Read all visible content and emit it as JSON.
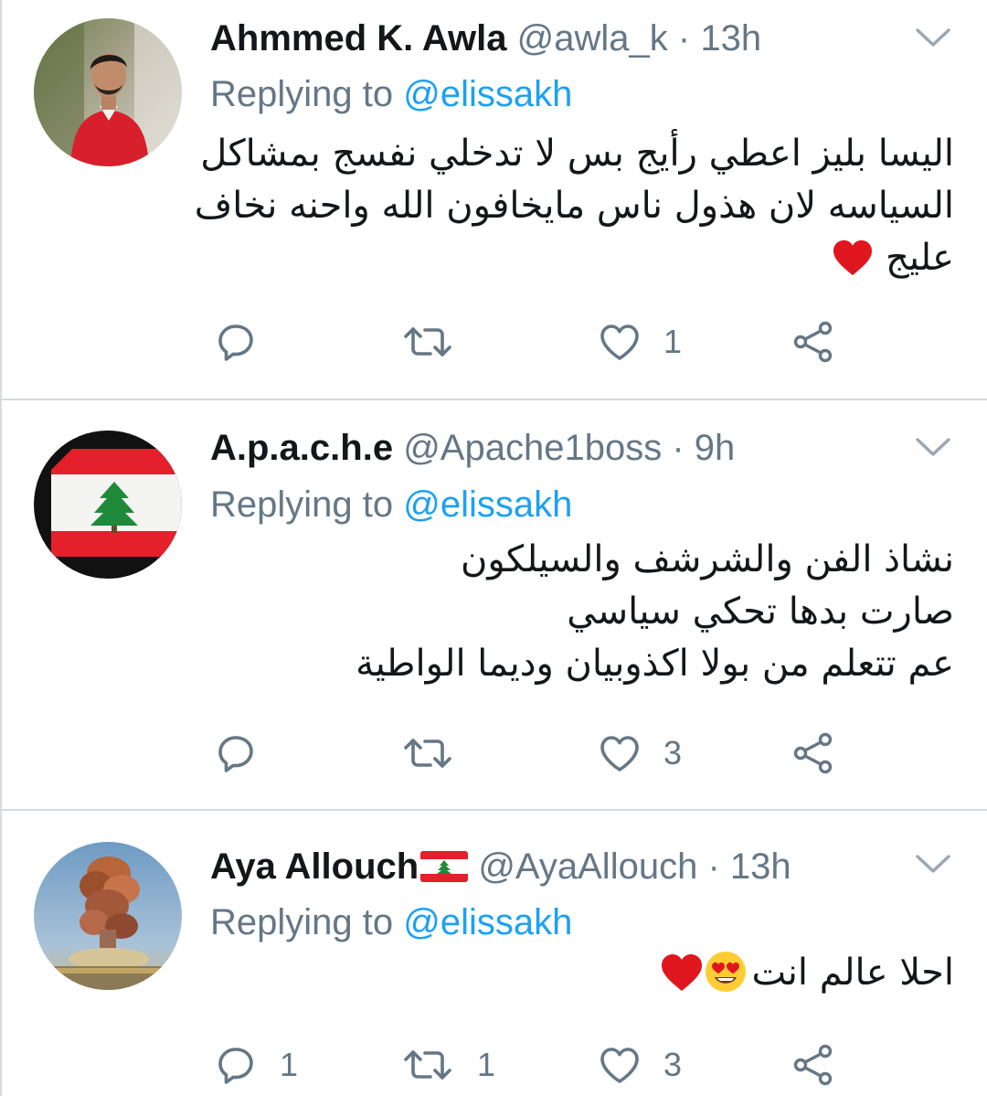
{
  "theme": {
    "text": "#14171a",
    "muted": "#657786",
    "link": "#1da1f2",
    "heart": "#e0161e",
    "divider": "#d6dadf"
  },
  "tweets": [
    {
      "name": "Ahmmed K. Awla",
      "handle": "@awla_k",
      "separator": "·",
      "time": "13h",
      "replying_label": "Replying to",
      "replying_to": "@elissakh",
      "text_lines": [
        "اليسا بليز اعطي رأيج بس لا تدخلي نفسج بمشاكل",
        "السياسه لان هذول ناس مايخافون الله واحنه نخاف",
        "عليج"
      ],
      "emoji": [
        "red-heart"
      ],
      "counts": {
        "reply": "",
        "retweet": "",
        "like": "1"
      },
      "avatar": "man-red-sweater-photo"
    },
    {
      "name": "A.p.a.c.h.e",
      "handle": "@Apache1boss",
      "separator": "·",
      "time": "9h",
      "replying_label": "Replying to",
      "replying_to": "@elissakh",
      "text_lines": [
        "نشاذ الفن  والشرشف والسيلكون",
        "صارت بدها تحكي سياسي",
        "عم تتعلم من بولا اكذوبيان وديما الواطية"
      ],
      "emoji": [],
      "counts": {
        "reply": "",
        "retweet": "",
        "like": "3"
      },
      "avatar": "lebanon-flag-with-mourning-ribbon"
    },
    {
      "name": "Aya Allouch",
      "handle": "@AyaAllouch",
      "separator": "·",
      "time": "13h",
      "replying_label": "Replying to",
      "replying_to": "@elissakh",
      "text_lines": [
        "احلا عالم انت"
      ],
      "emoji": [
        "heart-eyes-face",
        "red-heart"
      ],
      "counts": {
        "reply": "1",
        "retweet": "1",
        "like": "3"
      },
      "avatar": "beirut-explosion-cloud-photo",
      "name_badge": "lebanon-flag"
    }
  ]
}
